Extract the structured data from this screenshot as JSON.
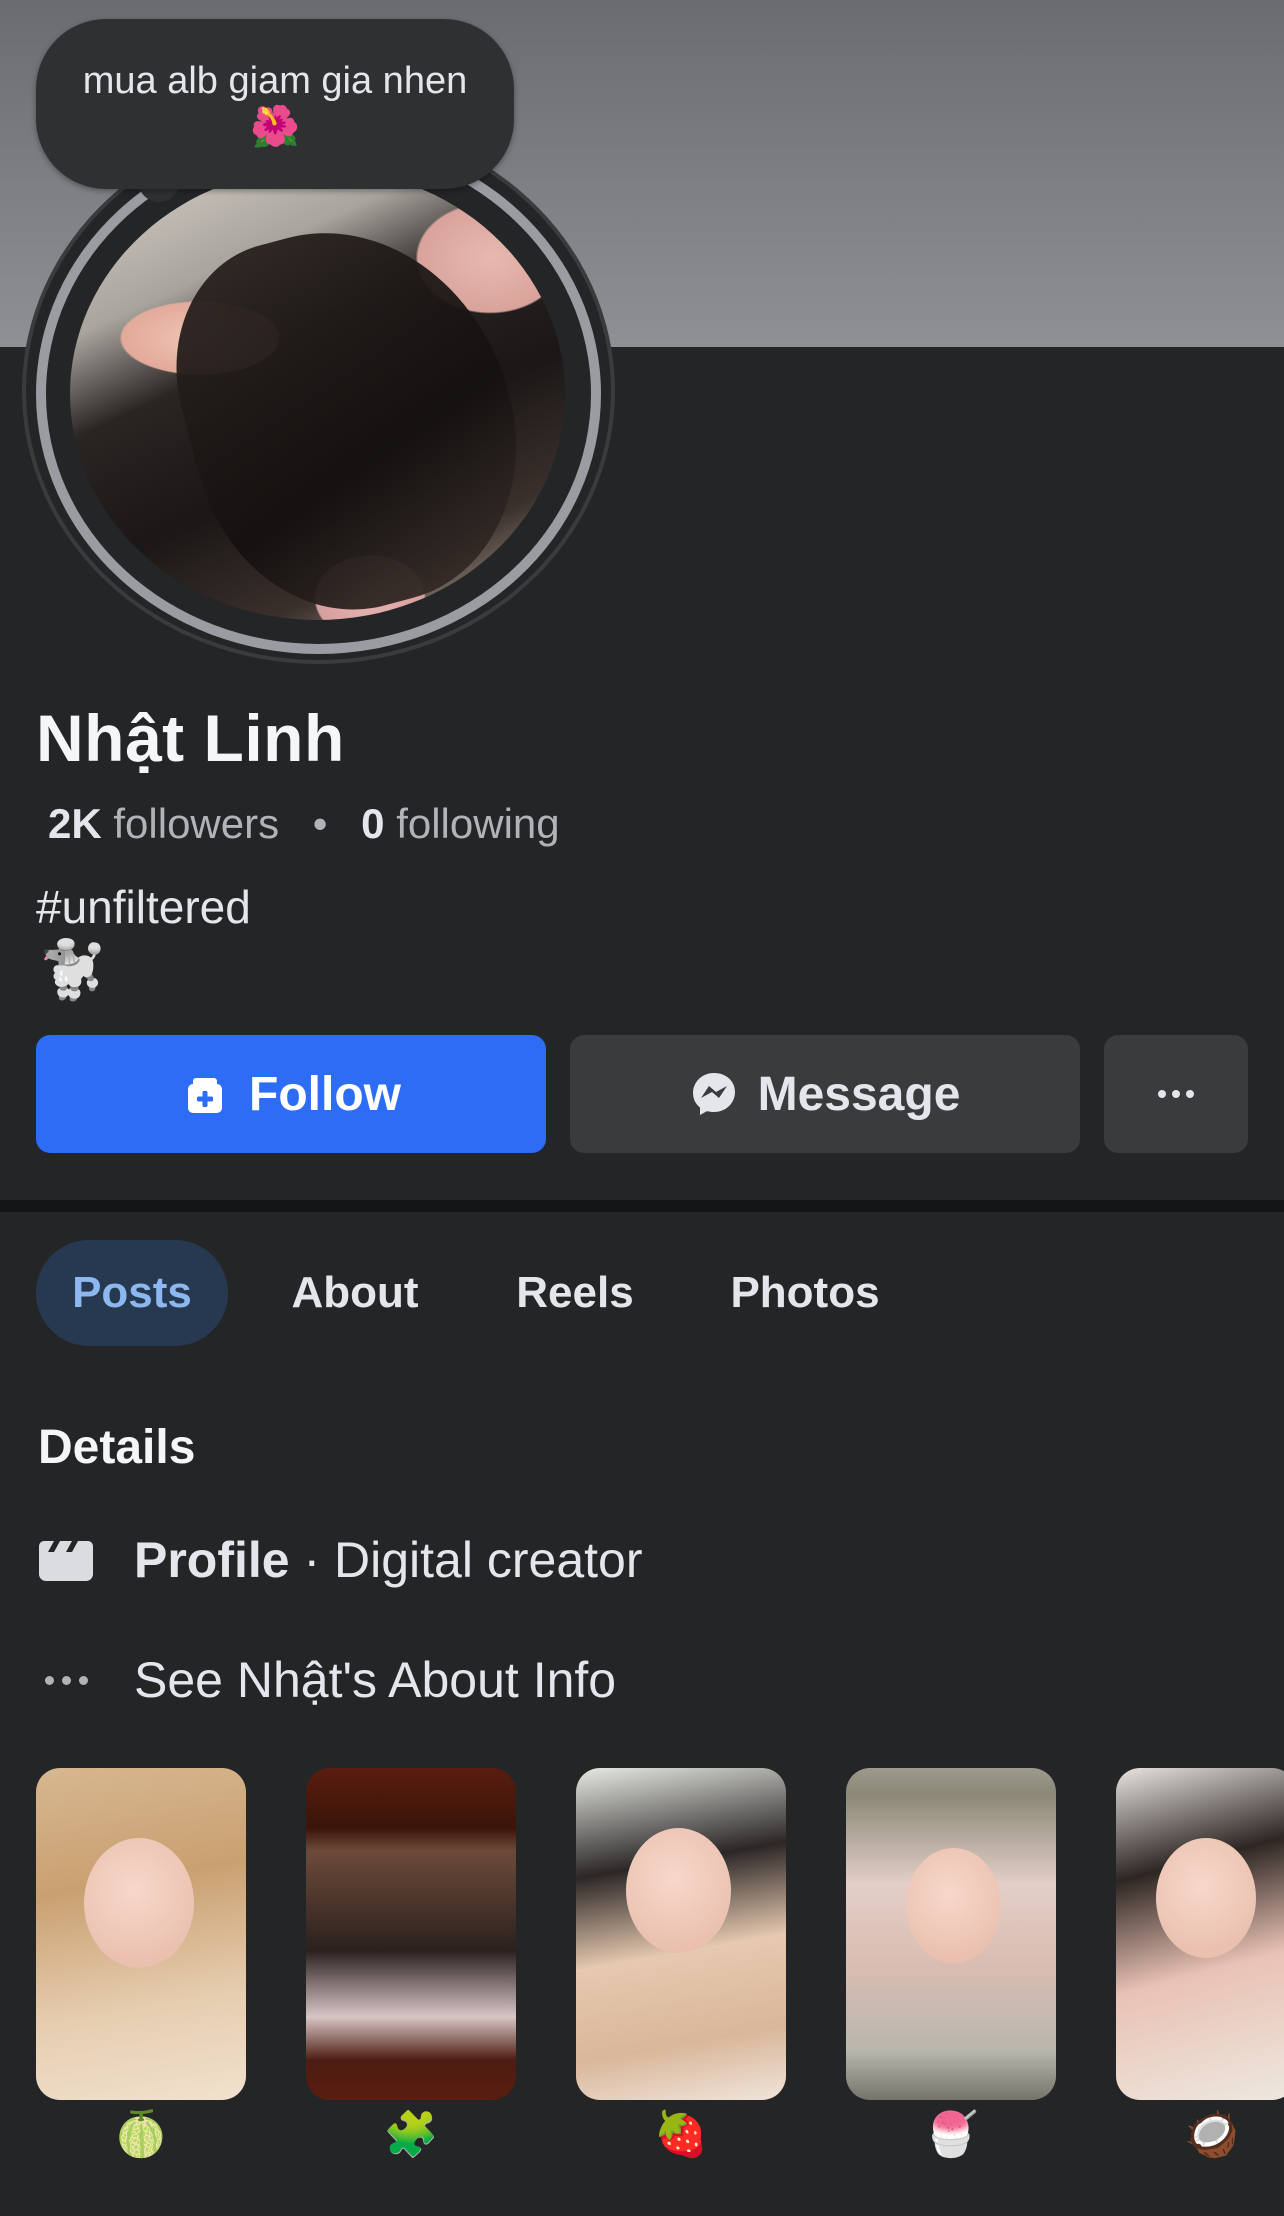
{
  "profile": {
    "note": "mua alb giam gia nhen",
    "note_emoji": "🌺",
    "name": "Nhật Linh",
    "followers_count": "2K",
    "followers_label": "followers",
    "following_count": "0",
    "following_label": "following",
    "stats_separator": "•",
    "bio": "#unfiltered",
    "bio_emoji": "🐩"
  },
  "actions": {
    "follow_label": "Follow",
    "message_label": "Message"
  },
  "tabs": [
    {
      "label": "Posts",
      "active": true
    },
    {
      "label": "About",
      "active": false
    },
    {
      "label": "Reels",
      "active": false
    },
    {
      "label": "Photos",
      "active": false
    }
  ],
  "details": {
    "title": "Details",
    "profile_key": "Profile",
    "profile_value": " · Digital creator",
    "about_link": "See Nhật's About Info"
  },
  "highlights": [
    {
      "caption_emoji": "🍈"
    },
    {
      "caption_emoji": "🧩"
    },
    {
      "caption_emoji": "🍓"
    },
    {
      "caption_emoji": "🍧"
    },
    {
      "caption_emoji": "🥥"
    }
  ],
  "colors": {
    "accent": "#2d6cf5",
    "background": "#242527",
    "active_tab_bg": "#263951",
    "active_tab_text": "#8db7ef"
  },
  "icons": {
    "follow": "add-friend-icon",
    "message": "messenger-icon",
    "more": "more-dots-icon",
    "profile_detail": "clapperboard-icon",
    "about_info": "ellipsis-icon"
  }
}
